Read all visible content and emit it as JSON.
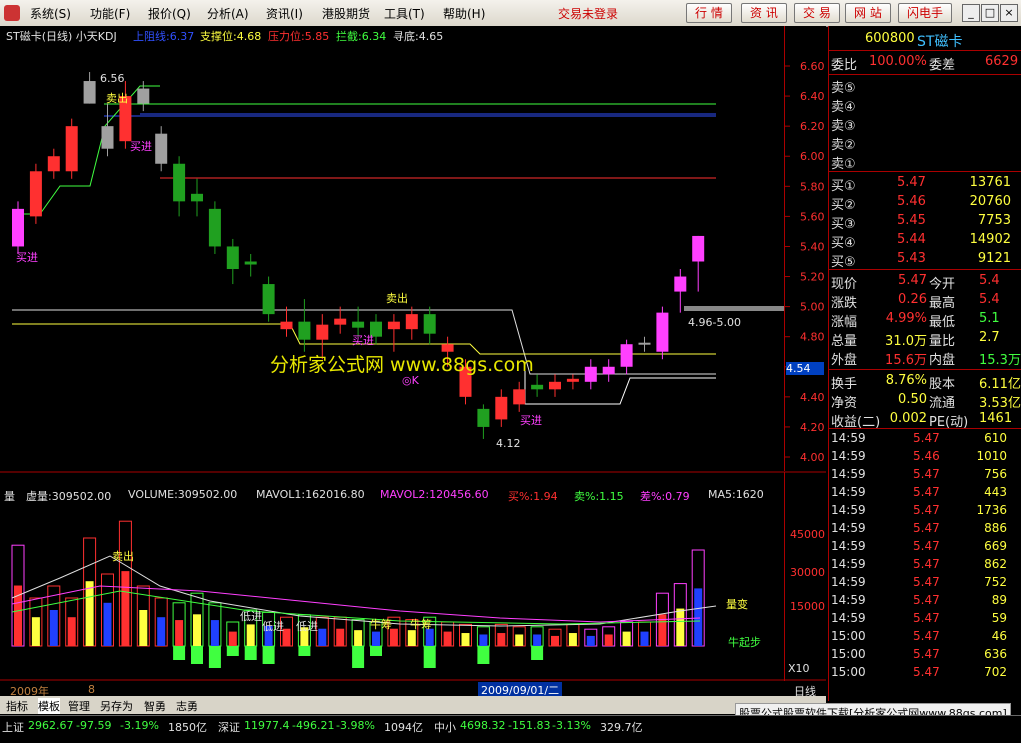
{
  "menu": {
    "items": [
      "系统(S)",
      "功能(F)",
      "报价(Q)",
      "分析(A)",
      "资讯(I)",
      "港股期货",
      "工具(T)",
      "帮助(H)"
    ],
    "status": "交易未登录",
    "buttons": [
      "行 情",
      "资 讯",
      "交 易",
      "网 站",
      "闪电手"
    ],
    "window_buttons": [
      "_",
      "□",
      "×"
    ]
  },
  "chart_header": {
    "title": "ST磁卡(日线) 小天KDJ",
    "items": [
      {
        "text": "上阻线:6.37",
        "color": "#3050ff"
      },
      {
        "text": "支撑位:4.68",
        "color": "#ffff40"
      },
      {
        "text": "压力位:5.85",
        "color": "#ff3030"
      },
      {
        "text": "拦截:6.34",
        "color": "#40ff40"
      },
      {
        "text": "寻底:4.65",
        "color": "#e0e0e0"
      }
    ]
  },
  "price_axis": [
    "6.60",
    "6.40",
    "6.20",
    "6.00",
    "5.80",
    "5.60",
    "5.40",
    "5.20",
    "5.00",
    "4.80",
    "4.60",
    "4.40",
    "4.20",
    "4.00"
  ],
  "price_current": "4.54",
  "annotations": {
    "high": "6.56",
    "low": "4.12",
    "range": "4.96-5.00",
    "sell1": "卖出",
    "sell2": "卖出",
    "buy1": "买进",
    "buy2": "买进",
    "buy3": "买进",
    "buy4": "买进",
    "ok": "◎K",
    "watermark": "分析家公式网  www.88gs.com"
  },
  "volume_header": {
    "title": "量",
    "items": [
      {
        "text": "虚量:309502.00",
        "color": "#e0e0e0"
      },
      {
        "text": "VOLUME:309502.00",
        "color": "#e0e0e0"
      },
      {
        "text": "MAVOL1:162016.80",
        "color": "#e0e0e0"
      },
      {
        "text": "MAVOL2:120456.60",
        "color": "#ff40ff"
      },
      {
        "text": "买%:1.94",
        "color": "#ff3030"
      },
      {
        "text": "卖%:1.15",
        "color": "#40ff40"
      },
      {
        "text": "差%:0.79",
        "color": "#ff40ff"
      },
      {
        "text": "MA5:1620",
        "color": "#e0e0e0"
      }
    ]
  },
  "volume_axis": [
    "45000",
    "30000",
    "15000"
  ],
  "volume_annotations": {
    "sell": "卖出",
    "lowbuy1": "低进",
    "lowbuy2": "低进",
    "lowbuy3": "低进",
    "bull1": "牛筹",
    "bull2": "牛筹",
    "vol_change": "量变",
    "bull_start": "牛起步",
    "x10": "X10"
  },
  "date_axis": {
    "left": "2009年",
    "mid": "8",
    "cursor": "2009/09/01/二",
    "right": "日线"
  },
  "tabs": [
    "指标",
    "模板",
    "管理",
    "另存为",
    "智勇",
    "志勇"
  ],
  "quote": {
    "code": "600800",
    "name": "ST磁卡",
    "weibi_label": "委比",
    "weibi_value": "100.00%",
    "weicha_label": "委差",
    "weicha_value": "6629",
    "sells": [
      "卖⑤",
      "卖④",
      "卖③",
      "卖②",
      "卖①"
    ],
    "buys": [
      {
        "label": "买①",
        "price": "5.47",
        "vol": "13761"
      },
      {
        "label": "买②",
        "price": "5.46",
        "vol": "20760"
      },
      {
        "label": "买③",
        "price": "5.45",
        "vol": "7753"
      },
      {
        "label": "买④",
        "price": "5.44",
        "vol": "14902"
      },
      {
        "label": "买⑤",
        "price": "5.43",
        "vol": "9121"
      }
    ],
    "stats": [
      {
        "l1": "现价",
        "v1": "5.47",
        "c1": "#ff3030",
        "l2": "今开",
        "v2": "5.4",
        "c2": "#ff3030"
      },
      {
        "l1": "涨跌",
        "v1": "0.26",
        "c1": "#ff3030",
        "l2": "最高",
        "v2": "5.4",
        "c2": "#ff3030"
      },
      {
        "l1": "涨幅",
        "v1": "4.99%",
        "c1": "#ff3030",
        "l2": "最低",
        "v2": "5.1",
        "c2": "#40ff40"
      },
      {
        "l1": "总量",
        "v1": "31.0万",
        "c1": "#ffff40",
        "l2": "量比",
        "v2": "2.7",
        "c2": "#ffff40"
      },
      {
        "l1": "外盘",
        "v1": "15.6万",
        "c1": "#ff3030",
        "l2": "内盘",
        "v2": "15.3万",
        "c2": "#40ff40"
      }
    ],
    "stats2": [
      {
        "l1": "换手",
        "v1": "8.76%",
        "l2": "股本",
        "v2": "6.11亿"
      },
      {
        "l1": "净资",
        "v1": "0.50",
        "l2": "流通",
        "v2": "3.53亿"
      },
      {
        "l1": "收益(二)",
        "v1": "0.002",
        "l2": "PE(动)",
        "v2": "1461"
      }
    ],
    "ticks": [
      {
        "t": "14:59",
        "p": "5.47",
        "v": "610"
      },
      {
        "t": "14:59",
        "p": "5.46",
        "v": "1010"
      },
      {
        "t": "14:59",
        "p": "5.47",
        "v": "756"
      },
      {
        "t": "14:59",
        "p": "5.47",
        "v": "443"
      },
      {
        "t": "14:59",
        "p": "5.47",
        "v": "1736"
      },
      {
        "t": "14:59",
        "p": "5.47",
        "v": "886"
      },
      {
        "t": "14:59",
        "p": "5.47",
        "v": "669"
      },
      {
        "t": "14:59",
        "p": "5.47",
        "v": "862"
      },
      {
        "t": "14:59",
        "p": "5.47",
        "v": "752"
      },
      {
        "t": "14:59",
        "p": "5.47",
        "v": "89"
      },
      {
        "t": "14:59",
        "p": "5.47",
        "v": "59"
      },
      {
        "t": "15:00",
        "p": "5.47",
        "v": "46"
      },
      {
        "t": "15:00",
        "p": "5.47",
        "v": "636"
      },
      {
        "t": "15:00",
        "p": "5.47",
        "v": "702"
      }
    ]
  },
  "ticker": [
    {
      "name": "上证",
      "val": "2962.67",
      "chg": "-97.59",
      "pct": "-3.19%",
      "amt": "1850亿"
    },
    {
      "name": "深证",
      "val": "11977.4",
      "chg": "-496.21",
      "pct": "-3.98%",
      "amt": "1094亿"
    },
    {
      "name": "中小",
      "val": "4698.32",
      "chg": "-151.83",
      "pct": "-3.13%",
      "amt": "329.7亿"
    }
  ],
  "ad_text": "股票公式股票软件下载[分析家公式网www.88gs.com]",
  "colors": {
    "up": "#ff3030",
    "down": "#40ff40",
    "accent": "#ffff40",
    "magenta": "#ff40ff"
  },
  "chart_data": {
    "type": "candlestick",
    "candles": [
      {
        "o": 5.4,
        "c": 5.65,
        "h": 5.7,
        "l": 5.35,
        "col": "m"
      },
      {
        "o": 5.6,
        "c": 5.9,
        "h": 5.95,
        "l": 5.55,
        "col": "r"
      },
      {
        "o": 5.9,
        "c": 6.0,
        "h": 6.05,
        "l": 5.85,
        "col": "r"
      },
      {
        "o": 5.9,
        "c": 6.2,
        "h": 6.25,
        "l": 5.85,
        "col": "r"
      },
      {
        "o": 6.35,
        "c": 6.5,
        "h": 6.56,
        "l": 6.35,
        "col": "w"
      },
      {
        "o": 6.2,
        "c": 6.05,
        "h": 6.35,
        "l": 6.0,
        "col": "w"
      },
      {
        "o": 6.4,
        "c": 6.1,
        "h": 6.5,
        "l": 6.05,
        "col": "r"
      },
      {
        "o": 6.35,
        "c": 6.45,
        "h": 6.5,
        "l": 6.3,
        "col": "w"
      },
      {
        "o": 6.15,
        "c": 5.95,
        "h": 6.2,
        "l": 5.9,
        "col": "w"
      },
      {
        "o": 5.95,
        "c": 5.7,
        "h": 6.0,
        "l": 5.6,
        "col": "g"
      },
      {
        "o": 5.75,
        "c": 5.7,
        "h": 5.85,
        "l": 5.6,
        "col": "g"
      },
      {
        "o": 5.65,
        "c": 5.4,
        "h": 5.7,
        "l": 5.35,
        "col": "g"
      },
      {
        "o": 5.4,
        "c": 5.25,
        "h": 5.45,
        "l": 5.15,
        "col": "g"
      },
      {
        "o": 5.3,
        "c": 5.28,
        "h": 5.35,
        "l": 5.2,
        "col": "g"
      },
      {
        "o": 5.15,
        "c": 4.95,
        "h": 5.2,
        "l": 4.9,
        "col": "g"
      },
      {
        "o": 4.85,
        "c": 4.9,
        "h": 5.0,
        "l": 4.8,
        "col": "r"
      },
      {
        "o": 4.9,
        "c": 4.78,
        "h": 5.05,
        "l": 4.7,
        "col": "g"
      },
      {
        "o": 4.78,
        "c": 4.88,
        "h": 4.95,
        "l": 4.65,
        "col": "r"
      },
      {
        "o": 4.88,
        "c": 4.92,
        "h": 5.0,
        "l": 4.82,
        "col": "r"
      },
      {
        "o": 4.9,
        "c": 4.86,
        "h": 5.0,
        "l": 4.8,
        "col": "g"
      },
      {
        "o": 4.8,
        "c": 4.9,
        "h": 4.95,
        "l": 4.75,
        "col": "g"
      },
      {
        "o": 4.85,
        "c": 4.9,
        "h": 4.95,
        "l": 4.7,
        "col": "r"
      },
      {
        "o": 4.85,
        "c": 4.95,
        "h": 5.0,
        "l": 4.78,
        "col": "r"
      },
      {
        "o": 4.95,
        "c": 4.82,
        "h": 5.0,
        "l": 4.75,
        "col": "g"
      },
      {
        "o": 4.7,
        "c": 4.75,
        "h": 4.8,
        "l": 4.6,
        "col": "r"
      },
      {
        "o": 4.6,
        "c": 4.4,
        "h": 4.65,
        "l": 4.35,
        "col": "r"
      },
      {
        "o": 4.32,
        "c": 4.2,
        "h": 4.35,
        "l": 4.12,
        "col": "g"
      },
      {
        "o": 4.25,
        "c": 4.4,
        "h": 4.45,
        "l": 4.2,
        "col": "r"
      },
      {
        "o": 4.35,
        "c": 4.45,
        "h": 4.5,
        "l": 4.3,
        "col": "r"
      },
      {
        "o": 4.45,
        "c": 4.48,
        "h": 4.55,
        "l": 4.4,
        "col": "g"
      },
      {
        "o": 4.45,
        "c": 4.5,
        "h": 4.55,
        "l": 4.4,
        "col": "r"
      },
      {
        "o": 4.5,
        "c": 4.52,
        "h": 4.55,
        "l": 4.45,
        "col": "r"
      },
      {
        "o": 4.5,
        "c": 4.6,
        "h": 4.65,
        "l": 4.45,
        "col": "m"
      },
      {
        "o": 4.55,
        "c": 4.6,
        "h": 4.65,
        "l": 4.5,
        "col": "m"
      },
      {
        "o": 4.6,
        "c": 4.75,
        "h": 4.78,
        "l": 4.55,
        "col": "m"
      },
      {
        "o": 4.75,
        "c": 4.76,
        "h": 4.8,
        "l": 4.7,
        "col": "w"
      },
      {
        "o": 4.7,
        "c": 4.96,
        "h": 5.0,
        "l": 4.65,
        "col": "m"
      },
      {
        "o": 5.1,
        "c": 5.2,
        "h": 5.25,
        "l": 4.96,
        "col": "m"
      },
      {
        "o": 5.3,
        "c": 5.47,
        "h": 5.47,
        "l": 5.1,
        "col": "m"
      }
    ],
    "volumes": [
      42,
      20,
      25,
      20,
      45,
      30,
      52,
      25,
      20,
      18,
      22,
      18,
      10,
      15,
      14,
      12,
      13,
      12,
      12,
      11,
      10,
      12,
      11,
      12,
      10,
      9,
      8,
      9,
      8,
      8,
      7,
      9,
      7,
      8,
      10,
      10,
      22,
      26,
      40
    ],
    "ylim": [
      4.0,
      6.6
    ]
  }
}
